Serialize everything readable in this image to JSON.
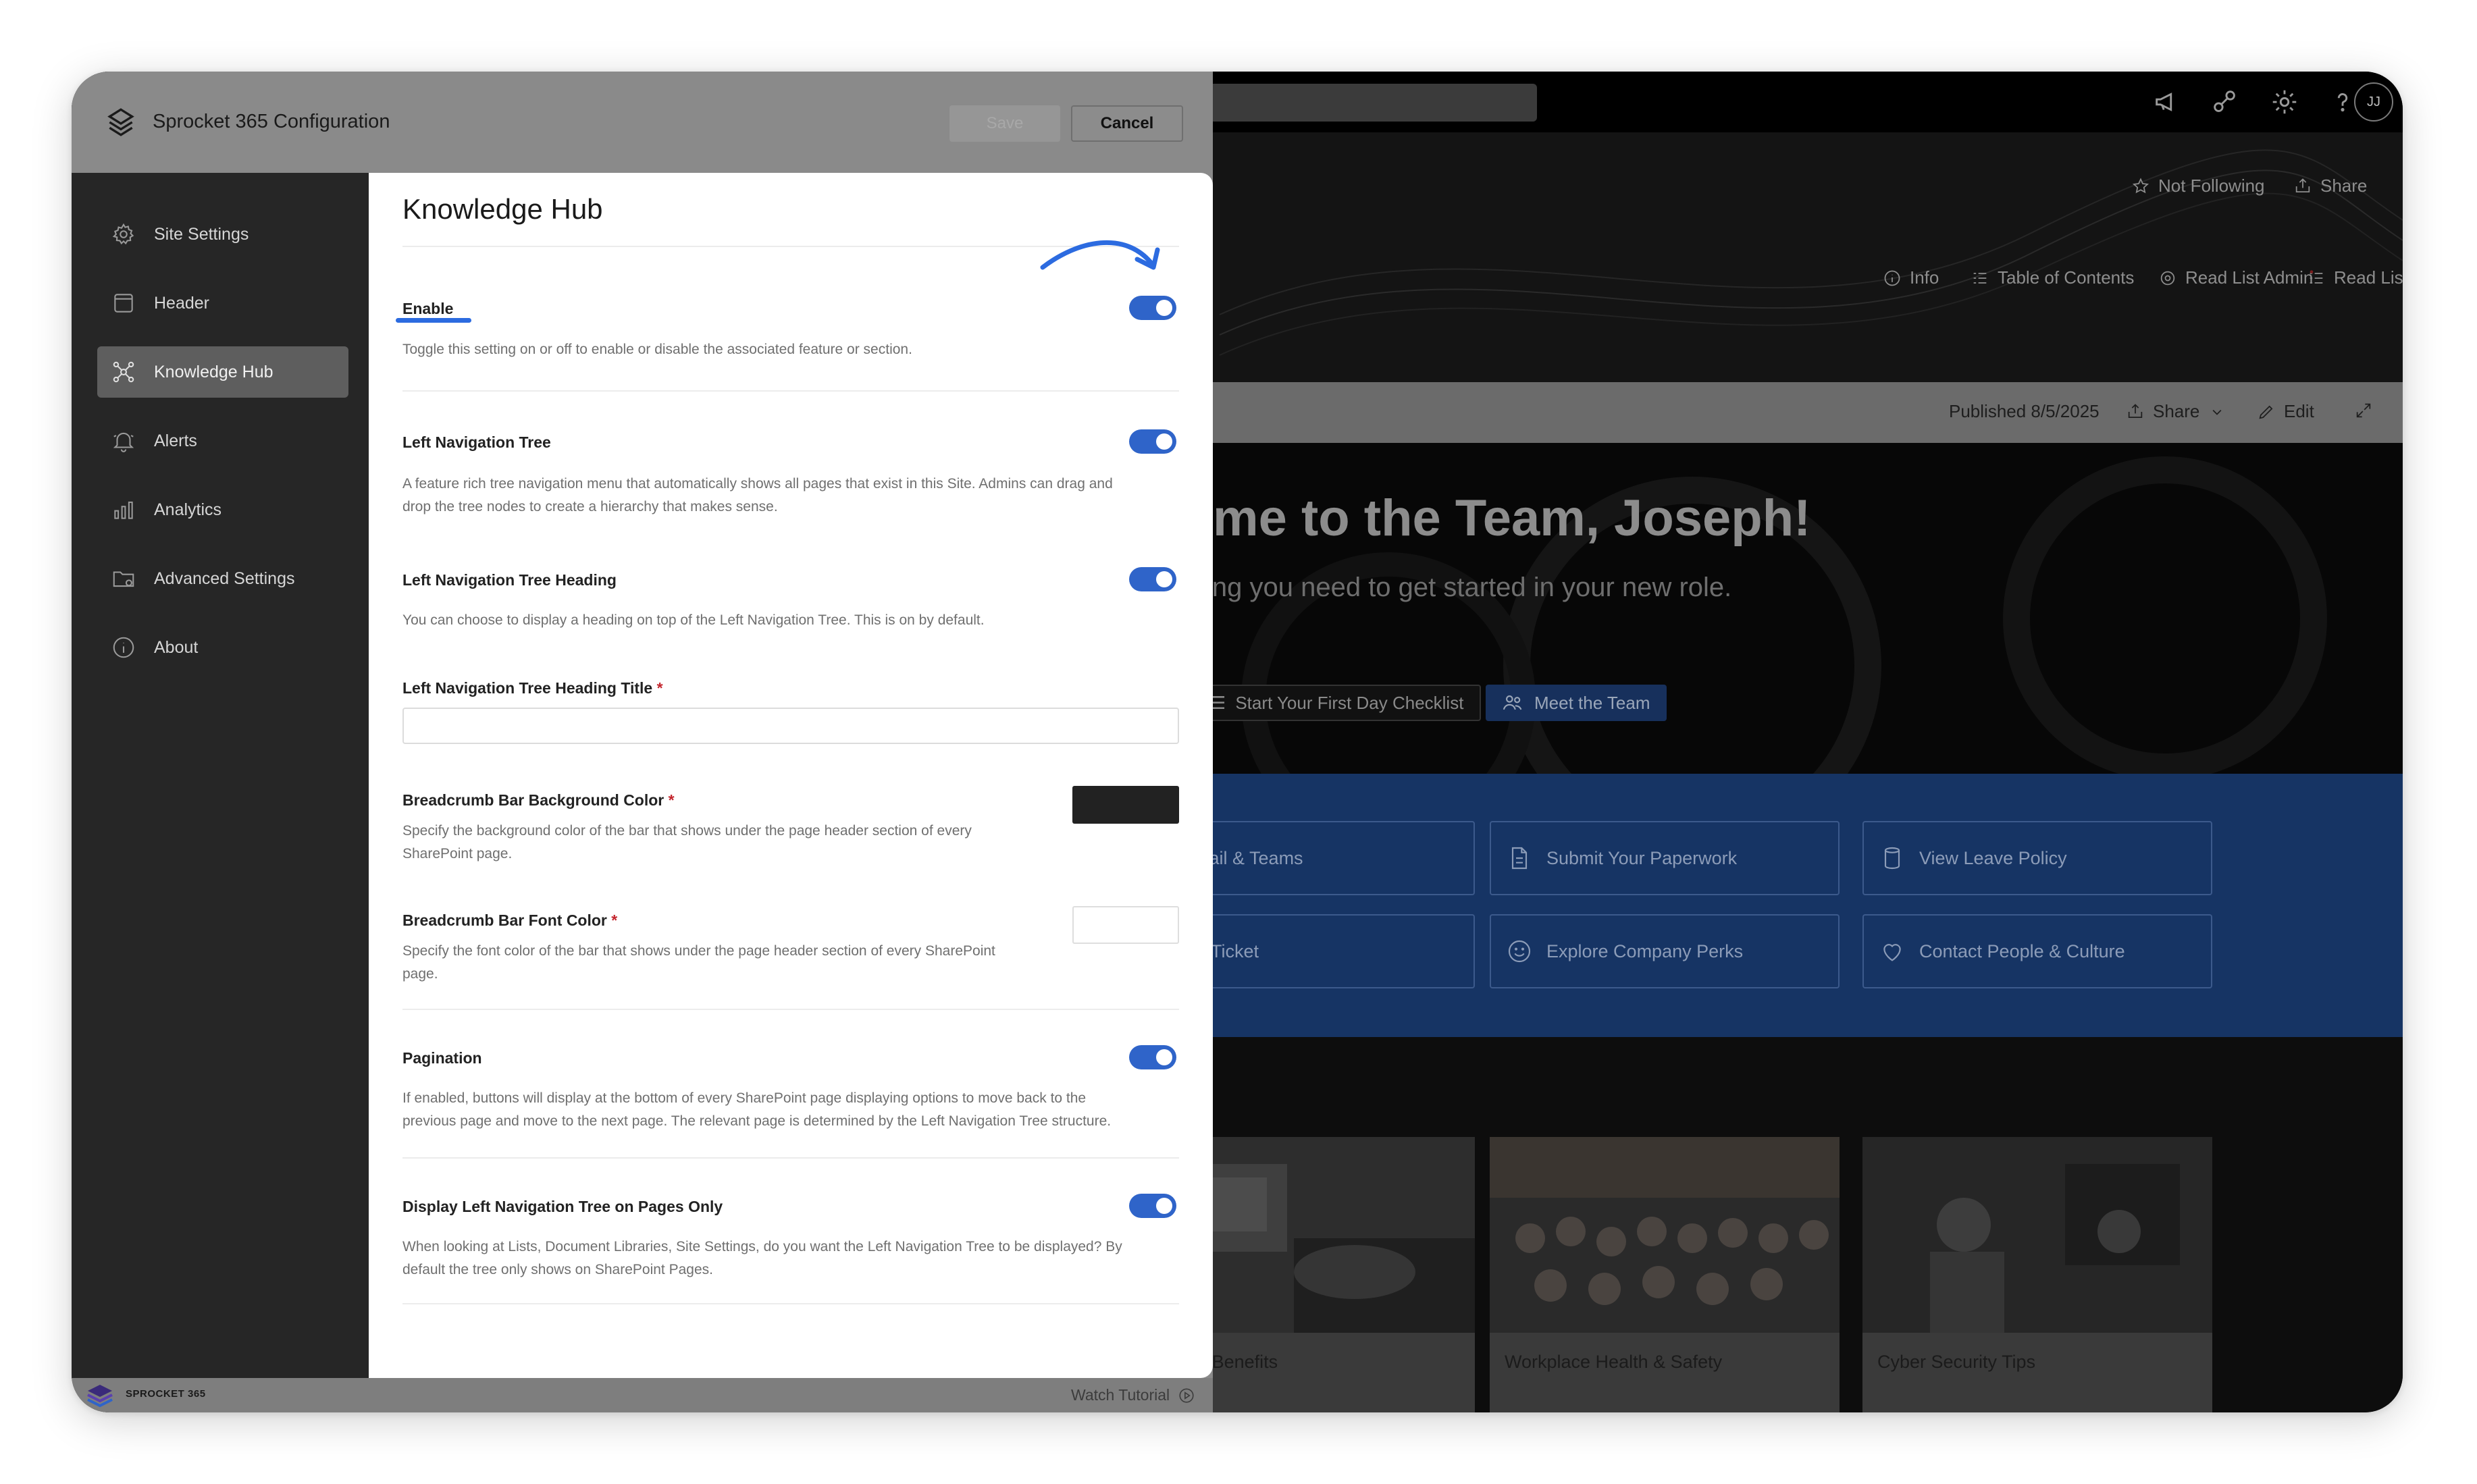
{
  "panel": {
    "title": "Sprocket 365 Configuration",
    "save_label": "Save",
    "cancel_label": "Cancel",
    "footer_brand": "SPROCKET 365",
    "watch_tutorial": "Watch Tutorial"
  },
  "sidebar": {
    "items": [
      {
        "label": "Site Settings",
        "icon": "gear-icon",
        "active": false
      },
      {
        "label": "Header",
        "icon": "window-icon",
        "active": false
      },
      {
        "label": "Knowledge Hub",
        "icon": "network-icon",
        "active": true
      },
      {
        "label": "Alerts",
        "icon": "bell-icon",
        "active": false
      },
      {
        "label": "Analytics",
        "icon": "bar-chart-icon",
        "active": false
      },
      {
        "label": "Advanced Settings",
        "icon": "folder-gear-icon",
        "active": false
      },
      {
        "label": "About",
        "icon": "info-icon",
        "active": false
      }
    ]
  },
  "content": {
    "title": "Knowledge Hub",
    "settings": {
      "enable": {
        "label": "Enable",
        "desc": "Toggle this setting on or off to enable or disable the associated feature or section.",
        "on": true
      },
      "left_nav_tree": {
        "label": "Left Navigation Tree",
        "desc": "A feature rich tree navigation menu that automatically shows all pages that exist in this Site. Admins can drag and drop the tree nodes to create a hierarchy that makes sense.",
        "on": true
      },
      "left_nav_heading": {
        "label": "Left Navigation Tree Heading",
        "desc": "You can choose to display a heading on top of the Left Navigation Tree. This is on by default.",
        "on": true
      },
      "heading_title": {
        "label": "Left Navigation Tree Heading Title",
        "required": "*",
        "value": ""
      },
      "breadcrumb_bg": {
        "label": "Breadcrumb Bar Background Color",
        "required": "*",
        "desc": "Specify the background color of the bar that shows under the page header section of every SharePoint page.",
        "color": "#222222"
      },
      "breadcrumb_font": {
        "label": "Breadcrumb Bar Font Color",
        "required": "*",
        "desc": "Specify the font color of the bar that shows under the page header section of every SharePoint page.",
        "color": "#ffffff"
      },
      "pagination": {
        "label": "Pagination",
        "desc": "If enabled, buttons will display at the bottom of every SharePoint page displaying options to move back to the previous page and move to the next page. The relevant page is determined by the Left Navigation Tree structure.",
        "on": true
      },
      "pages_only": {
        "label": "Display Left Navigation Tree on Pages Only",
        "desc": "When looking at Lists, Document Libraries, Site Settings, do you want the Left Navigation Tree to be displayed? By default the tree only shows on SharePoint Pages.",
        "on": true
      }
    }
  },
  "sharepoint": {
    "avatar_initials": "JJ",
    "not_following": "Not Following",
    "share_top": "Share",
    "commands": [
      "Info",
      "Table of Contents",
      "Read List Admin",
      "Read List"
    ],
    "published": "Published 8/5/2025",
    "share": "Share",
    "edit": "Edit",
    "welcome": "me to the Team, Joseph!",
    "subtitle": "ing you need to get started in your new role.",
    "checklist_btn": "Start Your First Day Checklist",
    "meet_btn": "Meet the Team",
    "quick_links": [
      "Email & Teams",
      "Submit Your Paperwork",
      "View Leave Policy",
      "elp Ticket",
      "Explore Company Perks",
      "Contact People & Culture"
    ],
    "news": [
      "Leave & Benefits",
      "Workplace Health & Safety",
      "Cyber Security Tips"
    ]
  },
  "colors": {
    "accent": "#2f64c9",
    "toggle_on": "#2f64c9",
    "required": "#c4262e",
    "sidebar_bg": "#262626"
  }
}
